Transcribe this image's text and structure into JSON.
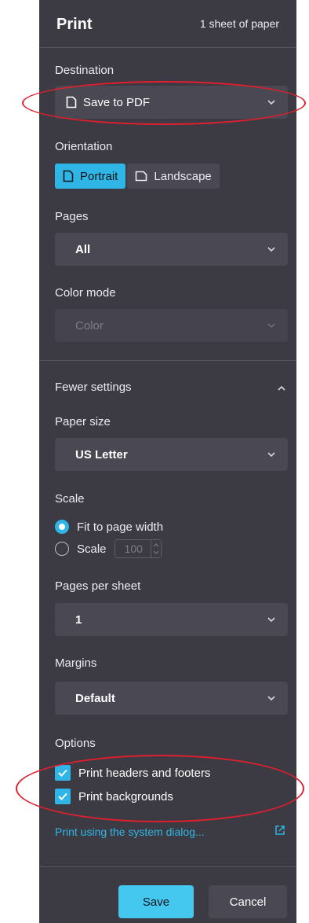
{
  "header": {
    "title": "Print",
    "sheet_count": "1 sheet of paper"
  },
  "destination": {
    "label": "Destination",
    "value": "Save to PDF"
  },
  "orientation": {
    "label": "Orientation",
    "portrait": "Portrait",
    "landscape": "Landscape",
    "selected": "Portrait"
  },
  "pages": {
    "label": "Pages",
    "value": "All"
  },
  "color_mode": {
    "label": "Color mode",
    "value": "Color",
    "disabled": true
  },
  "more_settings": {
    "label": "Fewer settings"
  },
  "paper_size": {
    "label": "Paper size",
    "value": "US Letter"
  },
  "scale": {
    "label": "Scale",
    "fit_label": "Fit to page width",
    "scale_label": "Scale",
    "scale_value": "100",
    "selected": "Fit to page width"
  },
  "pages_per_sheet": {
    "label": "Pages per sheet",
    "value": "1"
  },
  "margins": {
    "label": "Margins",
    "value": "Default"
  },
  "options": {
    "label": "Options",
    "items": [
      {
        "label": "Print headers and footers",
        "checked": true
      },
      {
        "label": "Print backgrounds",
        "checked": true
      }
    ]
  },
  "system_dialog_link": "Print using the system dialog...",
  "buttons": {
    "save": "Save",
    "cancel": "Cancel"
  },
  "colors": {
    "panel": "#3c3b44",
    "accent": "#2fb6e6",
    "annotation": "#e01f2e"
  },
  "icons": [
    "document-icon",
    "chevron-down-icon",
    "chevron-up-icon",
    "checkmark-icon",
    "external-link-icon"
  ]
}
